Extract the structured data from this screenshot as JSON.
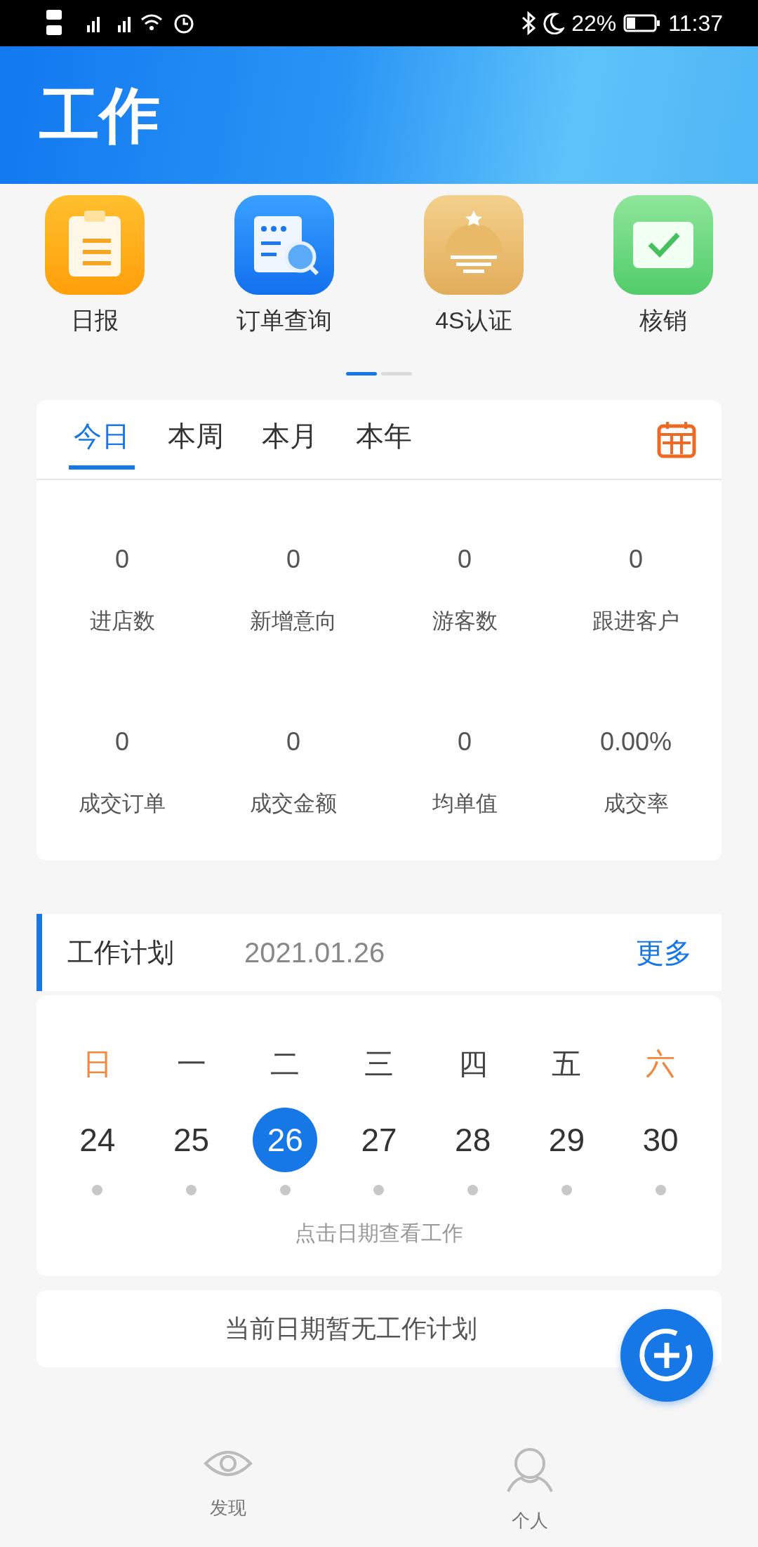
{
  "status_bar": {
    "battery": "22%",
    "time": "11:37"
  },
  "header": {
    "title": "工作"
  },
  "shortcuts": [
    {
      "label": "日报",
      "kind": "report"
    },
    {
      "label": "订单查询",
      "kind": "order"
    },
    {
      "label": "4S认证",
      "kind": "certify"
    },
    {
      "label": "核销",
      "kind": "ticket"
    }
  ],
  "pager": [
    {
      "selected": true
    },
    {
      "selected": false
    }
  ],
  "stats": {
    "tabs": [
      {
        "label": "今日",
        "selected": true
      },
      {
        "label": "本周",
        "selected": false
      },
      {
        "label": "本月",
        "selected": false
      },
      {
        "label": "本年",
        "selected": false
      }
    ],
    "items": [
      {
        "value": "0",
        "label": "进店数"
      },
      {
        "value": "0",
        "label": "新增意向"
      },
      {
        "value": "0",
        "label": "游客数"
      },
      {
        "value": "0",
        "label": "跟进客户"
      },
      {
        "value": "0",
        "label": "成交订单"
      },
      {
        "value": "0",
        "label": "成交金额"
      },
      {
        "value": "0",
        "label": "均单值"
      },
      {
        "value": "0.00%",
        "label": "成交率"
      }
    ]
  },
  "plan": {
    "title": "工作计划",
    "date": "2021.01.26",
    "more": "更多",
    "weekdays": [
      {
        "label": "日",
        "weekend": true
      },
      {
        "label": "一",
        "weekend": false
      },
      {
        "label": "二",
        "weekend": false
      },
      {
        "label": "三",
        "weekend": false
      },
      {
        "label": "四",
        "weekend": false
      },
      {
        "label": "五",
        "weekend": false
      },
      {
        "label": "六",
        "weekend": true
      }
    ],
    "days": [
      {
        "label": "24",
        "selected": false
      },
      {
        "label": "25",
        "selected": false
      },
      {
        "label": "26",
        "selected": true
      },
      {
        "label": "27",
        "selected": false
      },
      {
        "label": "28",
        "selected": false
      },
      {
        "label": "29",
        "selected": false
      },
      {
        "label": "30",
        "selected": false
      }
    ],
    "hint": "点击日期查看工作",
    "empty": "当前日期暂无工作计划"
  },
  "nav": [
    {
      "label": "发现",
      "kind": "discover"
    },
    {
      "label": "个人",
      "kind": "profile"
    }
  ]
}
